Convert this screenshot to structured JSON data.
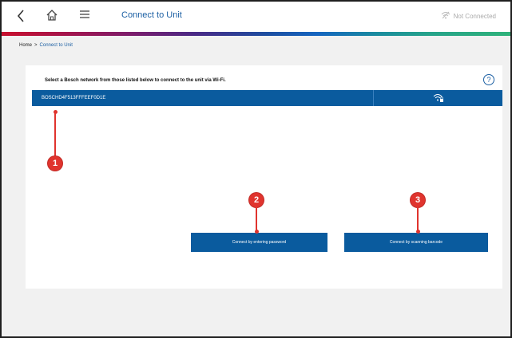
{
  "header": {
    "title": "Connect to Unit",
    "status": "Not Connected"
  },
  "breadcrumb": {
    "home": "Home",
    "separator": ">",
    "current": "Connect to Unit"
  },
  "panel": {
    "instruction": "Select a Bosch network from those listed below to connect to the unit via Wi-Fi.",
    "help_label": "?",
    "networks": [
      {
        "ssid": "BOSCHD4F513FFFEEF0D1E",
        "icon": "wifi-lock-icon"
      }
    ]
  },
  "buttons": {
    "password": "Connect by entering password",
    "barcode": "Connect by scanning barcode"
  },
  "markers": [
    "1",
    "2",
    "3"
  ],
  "colors": {
    "primary": "#0a5b9e",
    "marker": "#e0342e",
    "title": "#1b5fa3"
  }
}
